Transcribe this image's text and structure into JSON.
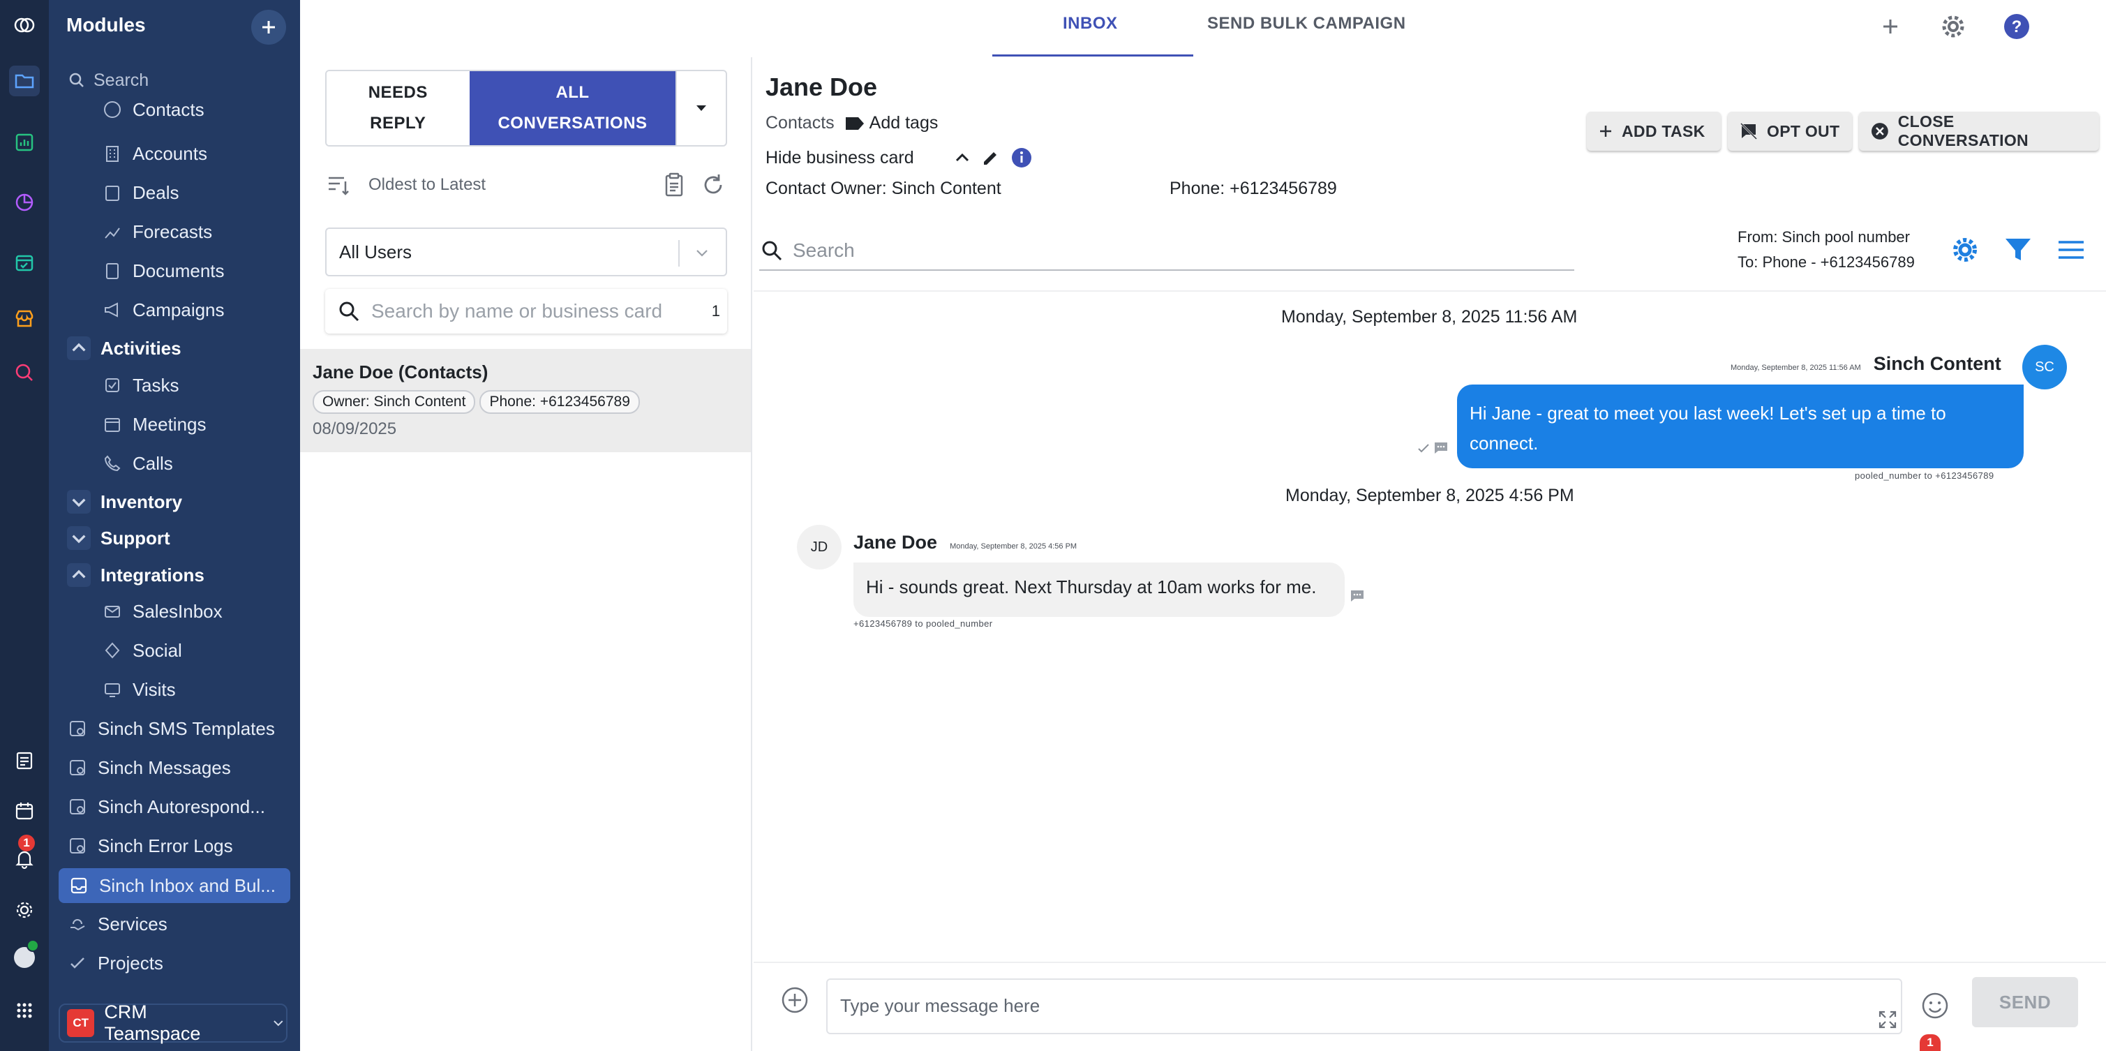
{
  "rail": {
    "notification_count": "1"
  },
  "sidebar": {
    "title": "Modules",
    "search_placeholder": "Search",
    "items": [
      {
        "label": "Contacts"
      },
      {
        "label": "Accounts"
      },
      {
        "label": "Deals"
      },
      {
        "label": "Forecasts"
      },
      {
        "label": "Documents"
      },
      {
        "label": "Campaigns"
      },
      {
        "label": "Activities"
      },
      {
        "label": "Tasks"
      },
      {
        "label": "Meetings"
      },
      {
        "label": "Calls"
      },
      {
        "label": "Inventory"
      },
      {
        "label": "Support"
      },
      {
        "label": "Integrations"
      },
      {
        "label": "SalesInbox"
      },
      {
        "label": "Social"
      },
      {
        "label": "Visits"
      },
      {
        "label": "Sinch SMS Templates"
      },
      {
        "label": "Sinch Messages"
      },
      {
        "label": "Sinch Autorespond..."
      },
      {
        "label": "Sinch Error Logs"
      },
      {
        "label": "Sinch Inbox and Bul..."
      },
      {
        "label": "Services"
      },
      {
        "label": "Projects"
      }
    ],
    "footer": {
      "badge": "CT",
      "label": "CRM Teamspace"
    }
  },
  "tabs": {
    "inbox": "INBOX",
    "bulk": "SEND BULK CAMPAIGN"
  },
  "list": {
    "needs_reply": "NEEDS REPLY",
    "all_conversations": "ALL CONVERSATIONS",
    "sort_label": "Oldest to Latest",
    "user_filter": "All Users",
    "search_placeholder": "Search by name or business card",
    "search_count": "1",
    "conversation": {
      "name": "Jane Doe (Contacts)",
      "owner": "Owner: Sinch Content",
      "phone": "Phone: +6123456789",
      "date": "08/09/2025"
    }
  },
  "conversation": {
    "contact_name": "Jane Doe",
    "module": "Contacts",
    "add_tags": "Add tags",
    "hide_card": "Hide business card",
    "owner": "Contact Owner: Sinch Content",
    "phone": "Phone: +6123456789",
    "add_task": "ADD TASK",
    "opt_out": "OPT OUT",
    "close": "CLOSE CONVERSATION",
    "search_placeholder": "Search",
    "from": "From: Sinch pool number",
    "to": "To: Phone - +6123456789",
    "messages": [
      {
        "day": "Monday, September 8, 2025 11:56 AM",
        "timestamp": "Monday, September 8, 2025 11:56 AM",
        "sender": "Sinch Content",
        "initials": "SC",
        "text": "Hi Jane - great to meet you last week! Let's set up a time to connect.",
        "route": "pooled_number to +6123456789"
      },
      {
        "day": "Monday, September 8, 2025 4:56 PM",
        "timestamp": "Monday, September 8, 2025 4:56 PM",
        "sender": "Jane Doe",
        "initials": "JD",
        "text": "Hi - sounds great. Next Thursday at 10am works for me.",
        "route": "+6123456789 to pooled_number"
      }
    ]
  },
  "composer": {
    "placeholder": "Type your message here",
    "send": "SEND",
    "badge": "1"
  },
  "colors": {
    "rail": "#1b2a45",
    "sidebar": "#233a63",
    "accent": "#3f51b5",
    "bubble_out": "#1a80e5",
    "selected_item": "#3d66b8"
  }
}
